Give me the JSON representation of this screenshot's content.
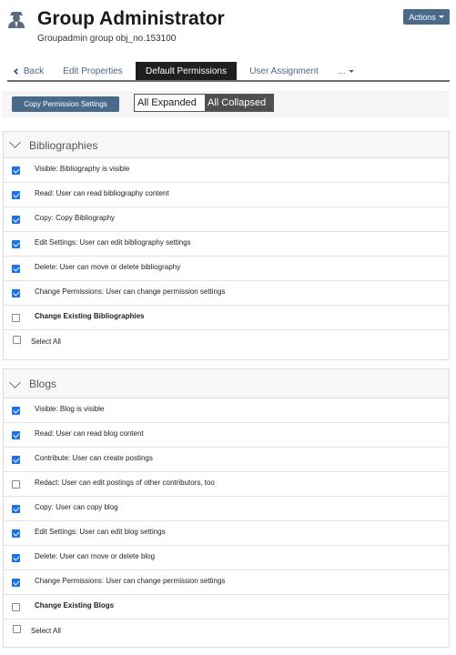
{
  "header": {
    "title": "Group Administrator",
    "subtitle": "Groupadmin group obj_no.153100",
    "icon": "group-admin-user-icon",
    "actions_label": "Actions"
  },
  "tabs": {
    "back": "Back",
    "edit_properties": "Edit Properties",
    "default_permissions": "Default Permissions",
    "user_assignment": "User Assignment",
    "more": "..."
  },
  "toolbar": {
    "copy_button": "Copy Permission Settings",
    "all_expanded": "All Expanded",
    "all_collapsed": "All Collapsed",
    "active_toggle": "All Collapsed"
  },
  "colors": {
    "button": "#4a6a8c",
    "active_tab": "#1f1f1f",
    "checkbox_checked": "#1a73e8"
  },
  "bibliographies": {
    "title": "Bibliographies",
    "items": [
      {
        "label": "Visible: Bibliography is visible",
        "checked": true
      },
      {
        "label": "Read: User can read bibliography content",
        "checked": true
      },
      {
        "label": "Copy: Copy Bibliography",
        "checked": true
      },
      {
        "label": "Edit Settings: User can edit bibliography settings",
        "checked": true
      },
      {
        "label": "Delete: User can move or delete bibliography",
        "checked": true
      },
      {
        "label": "Change Permissions: User can change permission settings",
        "checked": true
      },
      {
        "label": "Change Existing Bibliographies",
        "checked": false,
        "bold": true
      }
    ],
    "select_all": "Select All"
  },
  "blogs": {
    "title": "Blogs",
    "items": [
      {
        "label": "Visible: Blog is visible",
        "checked": true
      },
      {
        "label": "Read: User can read blog content",
        "checked": true
      },
      {
        "label": "Contribute: User can create postings",
        "checked": true
      },
      {
        "label": "Redact: User can edit postings of other contributors, too",
        "checked": false
      },
      {
        "label": "Copy: User can copy blog",
        "checked": true
      },
      {
        "label": "Edit Settings: User can edit blog settings",
        "checked": true
      },
      {
        "label": "Delete: User can move or delete blog",
        "checked": true
      },
      {
        "label": "Change Permissions: User can change permission settings",
        "checked": true
      },
      {
        "label": "Change Existing Blogs",
        "checked": false,
        "bold": true
      }
    ],
    "select_all": "Select All"
  }
}
